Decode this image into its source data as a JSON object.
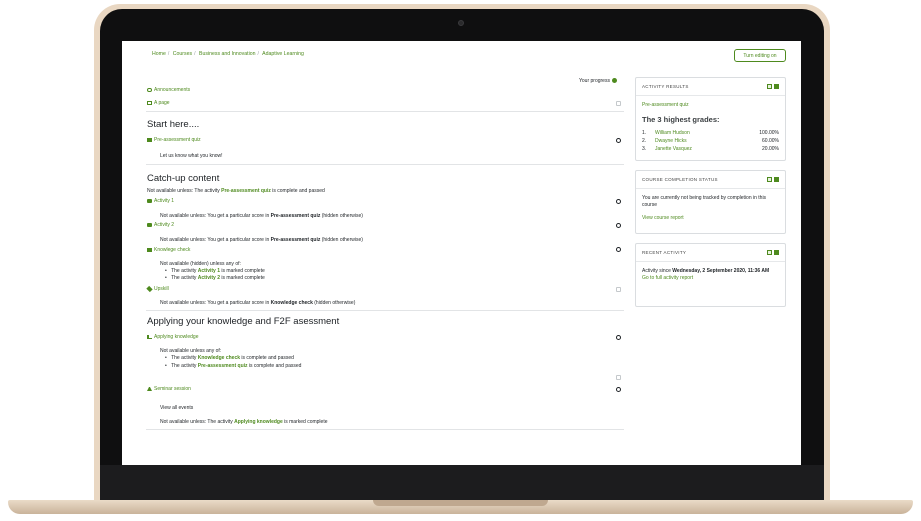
{
  "breadcrumb": [
    "Home",
    "Courses",
    "Business and Innovation",
    "Adaptive Learning"
  ],
  "edit_button": "Turn editing on",
  "progress_label": "Your progress",
  "top_items": {
    "announcements": "Announcements",
    "page": "A page"
  },
  "section1": {
    "title": "Start here....",
    "quiz": "Pre-assessment quiz",
    "desc": "Let us know what you know!"
  },
  "section2": {
    "title": "Catch-up content",
    "restriction_prefix": "Not available unless: The activity ",
    "restriction_link": "Pre-assessment quiz",
    "restriction_suffix": " is complete and passed",
    "activity1": "Activity 1",
    "activity1_prefix": "Not available unless: You get a particular score in ",
    "activity1_bold": "Pre-assessment quiz",
    "activity1_suffix": " (hidden otherwise)",
    "activity2": "Activity 2",
    "activity2_prefix": "Not available unless: You get a particular score in ",
    "activity2_bold": "Pre-assessment quiz",
    "activity2_suffix": " (hidden otherwise)",
    "knowledge": "Knowlege check",
    "knowledge_restrict": "Not available (hidden) unless any of:",
    "k_bullet1_prefix": "The activity ",
    "k_bullet1_link": "Activity 1",
    "k_bullet1_suffix": " is marked complete",
    "k_bullet2_prefix": "The activity ",
    "k_bullet2_link": "Activity 2",
    "k_bullet2_suffix": " is marked complete",
    "upskill": "Upskill",
    "upskill_prefix": "Not available unless: You get a particular score in ",
    "upskill_bold": "Knowledge check",
    "upskill_suffix": " (hidden otherwise)"
  },
  "section3": {
    "title": "Applying your knowledge and F2F asessment",
    "applying": "Applying knowledge",
    "applying_restrict": "Not available unless any of:",
    "a_bullet1_prefix": "The activity ",
    "a_bullet1_link": "Knowledge check",
    "a_bullet1_suffix": " is complete and passed",
    "a_bullet2_prefix": "The activity ",
    "a_bullet2_link": "Pre-assessment quiz",
    "a_bullet2_suffix": " is complete and passed",
    "seminar": "Seminar session",
    "view_events": "View all events",
    "seminar_prefix": "Not available unless: The activity ",
    "seminar_link": "Applying knowledge",
    "seminar_suffix": " is marked complete"
  },
  "activity_results": {
    "title": "ACTIVITY RESULTS",
    "quiz": "Pre-assessment quiz",
    "heading": "The 3 highest grades:",
    "grades": [
      {
        "rank": "1.",
        "name": "William Hudson",
        "value": "100.00%"
      },
      {
        "rank": "2.",
        "name": "Dwayne Hicks",
        "value": "60.00%"
      },
      {
        "rank": "3.",
        "name": "Janette Vasquez",
        "value": "20.00%"
      }
    ]
  },
  "completion_status": {
    "title": "COURSE COMPLETION STATUS",
    "text": "You are currently not being tracked by completion in this course",
    "link": "View course report"
  },
  "recent_activity": {
    "title": "RECENT ACTIVITY",
    "prefix": "Activity since ",
    "date": "Wednesday, 2 September 2020, 11:36 AM",
    "link": "Go to full activity report"
  },
  "colors": {
    "accent": "#4e8a1e",
    "text": "#1d2125"
  }
}
